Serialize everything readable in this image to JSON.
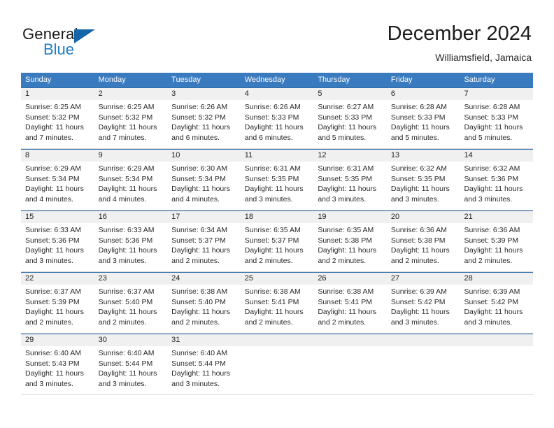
{
  "brand": {
    "name_top": "General",
    "name_bottom": "Blue",
    "accent_color": "#1f7ec4",
    "triangle_color": "#1566a8"
  },
  "header": {
    "title": "December 2024",
    "location": "Williamsfield, Jamaica"
  },
  "calendar": {
    "header_bg": "#3a7bbf",
    "daynum_bg": "#f0f0f0",
    "weekdays": [
      "Sunday",
      "Monday",
      "Tuesday",
      "Wednesday",
      "Thursday",
      "Friday",
      "Saturday"
    ],
    "weeks": [
      [
        {
          "day": "1",
          "sunrise": "Sunrise: 6:25 AM",
          "sunset": "Sunset: 5:32 PM",
          "daylight1": "Daylight: 11 hours",
          "daylight2": "and 7 minutes."
        },
        {
          "day": "2",
          "sunrise": "Sunrise: 6:25 AM",
          "sunset": "Sunset: 5:32 PM",
          "daylight1": "Daylight: 11 hours",
          "daylight2": "and 7 minutes."
        },
        {
          "day": "3",
          "sunrise": "Sunrise: 6:26 AM",
          "sunset": "Sunset: 5:32 PM",
          "daylight1": "Daylight: 11 hours",
          "daylight2": "and 6 minutes."
        },
        {
          "day": "4",
          "sunrise": "Sunrise: 6:26 AM",
          "sunset": "Sunset: 5:33 PM",
          "daylight1": "Daylight: 11 hours",
          "daylight2": "and 6 minutes."
        },
        {
          "day": "5",
          "sunrise": "Sunrise: 6:27 AM",
          "sunset": "Sunset: 5:33 PM",
          "daylight1": "Daylight: 11 hours",
          "daylight2": "and 5 minutes."
        },
        {
          "day": "6",
          "sunrise": "Sunrise: 6:28 AM",
          "sunset": "Sunset: 5:33 PM",
          "daylight1": "Daylight: 11 hours",
          "daylight2": "and 5 minutes."
        },
        {
          "day": "7",
          "sunrise": "Sunrise: 6:28 AM",
          "sunset": "Sunset: 5:33 PM",
          "daylight1": "Daylight: 11 hours",
          "daylight2": "and 5 minutes."
        }
      ],
      [
        {
          "day": "8",
          "sunrise": "Sunrise: 6:29 AM",
          "sunset": "Sunset: 5:34 PM",
          "daylight1": "Daylight: 11 hours",
          "daylight2": "and 4 minutes."
        },
        {
          "day": "9",
          "sunrise": "Sunrise: 6:29 AM",
          "sunset": "Sunset: 5:34 PM",
          "daylight1": "Daylight: 11 hours",
          "daylight2": "and 4 minutes."
        },
        {
          "day": "10",
          "sunrise": "Sunrise: 6:30 AM",
          "sunset": "Sunset: 5:34 PM",
          "daylight1": "Daylight: 11 hours",
          "daylight2": "and 4 minutes."
        },
        {
          "day": "11",
          "sunrise": "Sunrise: 6:31 AM",
          "sunset": "Sunset: 5:35 PM",
          "daylight1": "Daylight: 11 hours",
          "daylight2": "and 3 minutes."
        },
        {
          "day": "12",
          "sunrise": "Sunrise: 6:31 AM",
          "sunset": "Sunset: 5:35 PM",
          "daylight1": "Daylight: 11 hours",
          "daylight2": "and 3 minutes."
        },
        {
          "day": "13",
          "sunrise": "Sunrise: 6:32 AM",
          "sunset": "Sunset: 5:35 PM",
          "daylight1": "Daylight: 11 hours",
          "daylight2": "and 3 minutes."
        },
        {
          "day": "14",
          "sunrise": "Sunrise: 6:32 AM",
          "sunset": "Sunset: 5:36 PM",
          "daylight1": "Daylight: 11 hours",
          "daylight2": "and 3 minutes."
        }
      ],
      [
        {
          "day": "15",
          "sunrise": "Sunrise: 6:33 AM",
          "sunset": "Sunset: 5:36 PM",
          "daylight1": "Daylight: 11 hours",
          "daylight2": "and 3 minutes."
        },
        {
          "day": "16",
          "sunrise": "Sunrise: 6:33 AM",
          "sunset": "Sunset: 5:36 PM",
          "daylight1": "Daylight: 11 hours",
          "daylight2": "and 3 minutes."
        },
        {
          "day": "17",
          "sunrise": "Sunrise: 6:34 AM",
          "sunset": "Sunset: 5:37 PM",
          "daylight1": "Daylight: 11 hours",
          "daylight2": "and 2 minutes."
        },
        {
          "day": "18",
          "sunrise": "Sunrise: 6:35 AM",
          "sunset": "Sunset: 5:37 PM",
          "daylight1": "Daylight: 11 hours",
          "daylight2": "and 2 minutes."
        },
        {
          "day": "19",
          "sunrise": "Sunrise: 6:35 AM",
          "sunset": "Sunset: 5:38 PM",
          "daylight1": "Daylight: 11 hours",
          "daylight2": "and 2 minutes."
        },
        {
          "day": "20",
          "sunrise": "Sunrise: 6:36 AM",
          "sunset": "Sunset: 5:38 PM",
          "daylight1": "Daylight: 11 hours",
          "daylight2": "and 2 minutes."
        },
        {
          "day": "21",
          "sunrise": "Sunrise: 6:36 AM",
          "sunset": "Sunset: 5:39 PM",
          "daylight1": "Daylight: 11 hours",
          "daylight2": "and 2 minutes."
        }
      ],
      [
        {
          "day": "22",
          "sunrise": "Sunrise: 6:37 AM",
          "sunset": "Sunset: 5:39 PM",
          "daylight1": "Daylight: 11 hours",
          "daylight2": "and 2 minutes."
        },
        {
          "day": "23",
          "sunrise": "Sunrise: 6:37 AM",
          "sunset": "Sunset: 5:40 PM",
          "daylight1": "Daylight: 11 hours",
          "daylight2": "and 2 minutes."
        },
        {
          "day": "24",
          "sunrise": "Sunrise: 6:38 AM",
          "sunset": "Sunset: 5:40 PM",
          "daylight1": "Daylight: 11 hours",
          "daylight2": "and 2 minutes."
        },
        {
          "day": "25",
          "sunrise": "Sunrise: 6:38 AM",
          "sunset": "Sunset: 5:41 PM",
          "daylight1": "Daylight: 11 hours",
          "daylight2": "and 2 minutes."
        },
        {
          "day": "26",
          "sunrise": "Sunrise: 6:38 AM",
          "sunset": "Sunset: 5:41 PM",
          "daylight1": "Daylight: 11 hours",
          "daylight2": "and 2 minutes."
        },
        {
          "day": "27",
          "sunrise": "Sunrise: 6:39 AM",
          "sunset": "Sunset: 5:42 PM",
          "daylight1": "Daylight: 11 hours",
          "daylight2": "and 3 minutes."
        },
        {
          "day": "28",
          "sunrise": "Sunrise: 6:39 AM",
          "sunset": "Sunset: 5:42 PM",
          "daylight1": "Daylight: 11 hours",
          "daylight2": "and 3 minutes."
        }
      ],
      [
        {
          "day": "29",
          "sunrise": "Sunrise: 6:40 AM",
          "sunset": "Sunset: 5:43 PM",
          "daylight1": "Daylight: 11 hours",
          "daylight2": "and 3 minutes."
        },
        {
          "day": "30",
          "sunrise": "Sunrise: 6:40 AM",
          "sunset": "Sunset: 5:44 PM",
          "daylight1": "Daylight: 11 hours",
          "daylight2": "and 3 minutes."
        },
        {
          "day": "31",
          "sunrise": "Sunrise: 6:40 AM",
          "sunset": "Sunset: 5:44 PM",
          "daylight1": "Daylight: 11 hours",
          "daylight2": "and 3 minutes."
        },
        {
          "day": "",
          "sunrise": "",
          "sunset": "",
          "daylight1": "",
          "daylight2": ""
        },
        {
          "day": "",
          "sunrise": "",
          "sunset": "",
          "daylight1": "",
          "daylight2": ""
        },
        {
          "day": "",
          "sunrise": "",
          "sunset": "",
          "daylight1": "",
          "daylight2": ""
        },
        {
          "day": "",
          "sunrise": "",
          "sunset": "",
          "daylight1": "",
          "daylight2": ""
        }
      ]
    ]
  }
}
